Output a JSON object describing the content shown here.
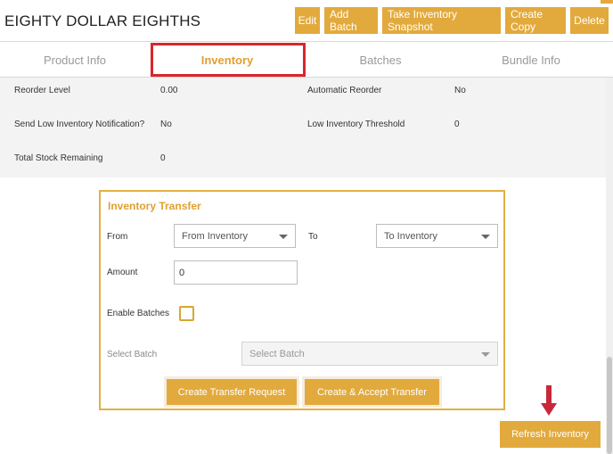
{
  "header": {
    "title": "EIGHTY DOLLAR EIGHTHS",
    "buttons": {
      "edit": "Edit",
      "add_batch": "Add Batch",
      "snapshot": "Take Inventory Snapshot",
      "create_copy": "Create Copy",
      "delete": "Delete"
    }
  },
  "tabs": {
    "product_info": "Product Info",
    "inventory": "Inventory",
    "batches": "Batches",
    "bundle_info": "Bundle Info",
    "active": "Inventory"
  },
  "info": {
    "reorder_level_label": "Reorder Level",
    "reorder_level_value": "0.00",
    "automatic_reorder_label": "Automatic Reorder",
    "automatic_reorder_value": "No",
    "low_notify_label": "Send Low Inventory Notification?",
    "low_notify_value": "No",
    "low_threshold_label": "Low Inventory Threshold",
    "low_threshold_value": "0",
    "total_stock_label": "Total Stock Remaining",
    "total_stock_value": "0"
  },
  "transfer": {
    "title": "Inventory Transfer",
    "from_label": "From",
    "from_value": "From Inventory",
    "to_label": "To",
    "to_value": "To Inventory",
    "amount_label": "Amount",
    "amount_value": "0",
    "enable_batches_label": "Enable Batches",
    "enable_batches_checked": false,
    "select_batch_label": "Select Batch",
    "select_batch_placeholder": "Select Batch",
    "create_request": "Create Transfer Request",
    "create_accept": "Create & Accept Transfer"
  },
  "refresh_button": "Refresh Inventory",
  "colors": {
    "accent": "#e2aa3c",
    "highlight": "#d9262b"
  }
}
